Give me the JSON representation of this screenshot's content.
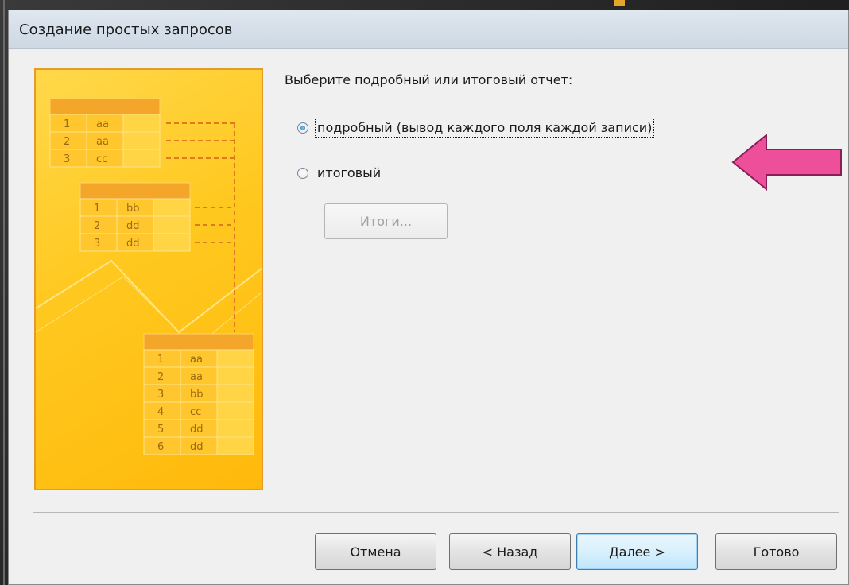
{
  "window": {
    "title": "Создание простых запросов"
  },
  "illustration": {
    "table_a": [
      [
        "1",
        "aa"
      ],
      [
        "2",
        "aa"
      ],
      [
        "3",
        "cc"
      ]
    ],
    "table_b": [
      [
        "1",
        "bb"
      ],
      [
        "2",
        "dd"
      ],
      [
        "3",
        "dd"
      ]
    ],
    "table_c": [
      [
        "1",
        "aa"
      ],
      [
        "2",
        "aa"
      ],
      [
        "3",
        "bb"
      ],
      [
        "4",
        "cc"
      ],
      [
        "5",
        "dd"
      ],
      [
        "6",
        "dd"
      ]
    ]
  },
  "prompt": "Выберите подробный или итоговый отчет:",
  "options": [
    {
      "label": "подробный (вывод каждого поля каждой записи)",
      "selected": true
    },
    {
      "label": "итоговый",
      "selected": false
    }
  ],
  "totals_button": "Итоги...",
  "footer": {
    "cancel": "Отмена",
    "back": "< Назад",
    "next": "Далее >",
    "finish": "Готово"
  },
  "colors": {
    "arrow": "#ee4f9a",
    "illustration_bg": "#ffc81f",
    "default_button": "#3c7fb1"
  }
}
